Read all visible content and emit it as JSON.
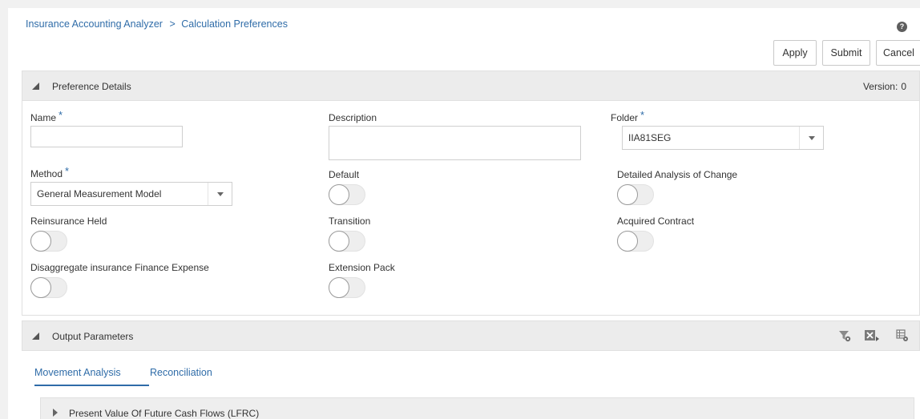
{
  "breadcrumb": {
    "root": "Insurance Accounting Analyzer",
    "separator": ">",
    "current": "Calculation Preferences"
  },
  "help_icon": "?",
  "actions": {
    "apply": "Apply",
    "submit": "Submit",
    "cancel": "Cancel"
  },
  "preference_details": {
    "title": "Preference Details",
    "version_label": "Version:",
    "version_value": "0",
    "required_marker": "*",
    "name": {
      "label": "Name",
      "value": ""
    },
    "description": {
      "label": "Description",
      "value": ""
    },
    "folder": {
      "label": "Folder",
      "value": "IIA81SEG"
    },
    "method": {
      "label": "Method",
      "value": "General Measurement Model"
    },
    "default": {
      "label": "Default",
      "on": false
    },
    "detailed_analysis": {
      "label": "Detailed Analysis of Change",
      "on": false
    },
    "reinsurance_held": {
      "label": "Reinsurance Held",
      "on": false
    },
    "transition": {
      "label": "Transition",
      "on": false
    },
    "acquired_contract": {
      "label": "Acquired Contract",
      "on": false
    },
    "disaggregate": {
      "label": "Disaggregate insurance Finance Expense",
      "on": false
    },
    "extension_pack": {
      "label": "Extension Pack",
      "on": false
    }
  },
  "output_parameters": {
    "title": "Output Parameters",
    "icons": [
      "filter-icon",
      "export-excel-icon",
      "table-settings-icon"
    ],
    "tabs": [
      {
        "label": "Movement Analysis",
        "active": true
      },
      {
        "label": "Reconciliation",
        "active": false
      }
    ],
    "sections": [
      {
        "label": "Present Value Of Future Cash Flows (LFRC)",
        "expanded": false
      }
    ]
  },
  "colors": {
    "link": "#2f6ca8",
    "header_bg": "#ececec",
    "page_bg": "#f1f1f1"
  }
}
